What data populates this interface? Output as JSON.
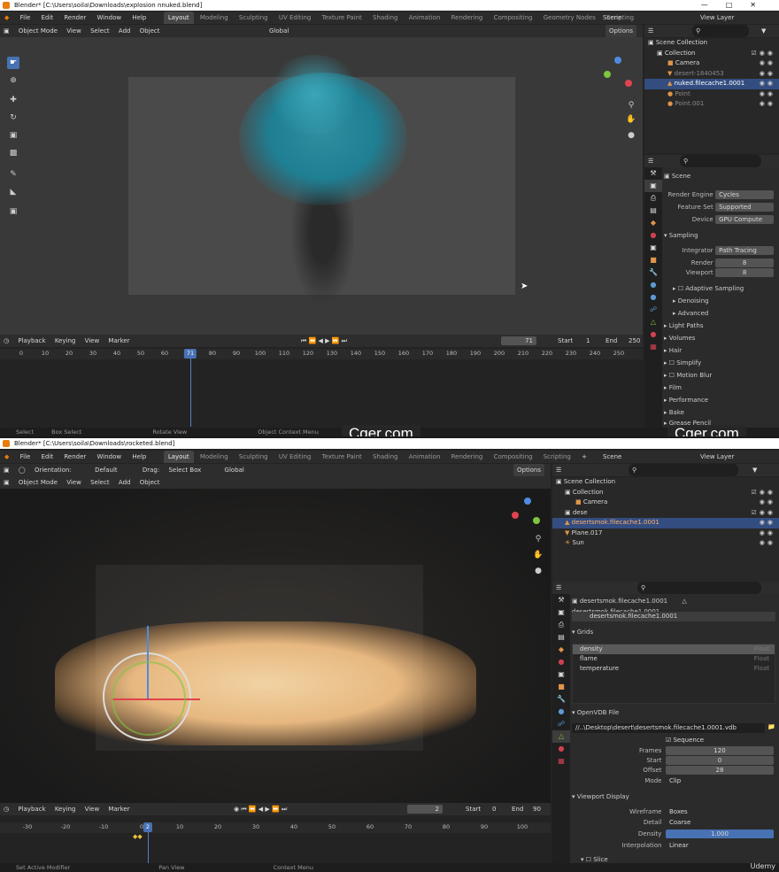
{
  "top": {
    "title": "Blender* [C:\\Users\\soila\\Downloads\\explosion nnuked.blend]",
    "menu": [
      "File",
      "Edit",
      "Render",
      "Window",
      "Help"
    ],
    "tabs": [
      "Layout",
      "Modeling",
      "Sculpting",
      "UV Editing",
      "Texture Paint",
      "Shading",
      "Animation",
      "Rendering",
      "Compositing",
      "Geometry Nodes",
      "Scripting"
    ],
    "scene": "Scene",
    "view_layer": "View Layer",
    "header": {
      "mode": "Object Mode",
      "view": "View",
      "select": "Select",
      "add": "Add",
      "object": "Object",
      "orientation": "Global",
      "options": "Options"
    },
    "outliner": {
      "rows": [
        {
          "name": "Scene Collection"
        },
        {
          "name": "Collection"
        },
        {
          "name": "Camera"
        },
        {
          "name": "desert-1840453"
        },
        {
          "name": "nuked.filecache1.0001"
        },
        {
          "name": "Point"
        },
        {
          "name": "Point.001"
        }
      ]
    },
    "props": {
      "context": "Scene",
      "render_engine_label": "Render Engine",
      "render_engine": "Cycles",
      "feature_set_label": "Feature Set",
      "feature_set": "Supported",
      "device_label": "Device",
      "device": "GPU Compute",
      "sampling": "Sampling",
      "integrator_label": "Integrator",
      "integrator": "Path Tracing",
      "render_label": "Render",
      "render": "8",
      "viewport_label": "Viewport",
      "viewport": "8",
      "adaptive": "Adaptive Sampling",
      "denoising": "Denoising",
      "advanced": "Advanced",
      "panels": [
        "Light Paths",
        "Volumes",
        "Hair",
        "Simplify",
        "Motion Blur",
        "Film",
        "Performance",
        "Bake",
        "Grease Pencil"
      ]
    },
    "timeline": {
      "menu": [
        "Playback",
        "Keying",
        "View",
        "Marker"
      ],
      "frame": "71",
      "start_label": "Start",
      "start": "1",
      "end_label": "End",
      "end": "250",
      "ticks": [
        "0",
        "10",
        "20",
        "30",
        "40",
        "50",
        "60",
        "70",
        "80",
        "90",
        "100",
        "110",
        "120",
        "130",
        "140",
        "150",
        "160",
        "170",
        "180",
        "190",
        "200",
        "210",
        "220",
        "230",
        "240",
        "250"
      ],
      "current": "71"
    },
    "status": [
      "Select",
      "Box Select",
      "Rotate View",
      "Object Context Menu"
    ]
  },
  "watermark": "Cger.com",
  "udemy": "Udemy",
  "bottom": {
    "title": "Blender* [C:\\Users\\soila\\Downloads\\rocketed.blend]",
    "menu": [
      "File",
      "Edit",
      "Render",
      "Window",
      "Help"
    ],
    "tabs": [
      "Layout",
      "Modeling",
      "Sculpting",
      "UV Editing",
      "Texture Paint",
      "Shading",
      "Animation",
      "Rendering",
      "Compositing",
      "Scripting"
    ],
    "scene": "Scene",
    "view_layer": "View Layer",
    "tool_header": {
      "orientation_label": "Orientation:",
      "orientation": "Default",
      "drag_label": "Drag:",
      "drag": "Select Box",
      "transform": "Global",
      "options": "Options"
    },
    "header": {
      "mode": "Object Mode",
      "view": "View",
      "select": "Select",
      "add": "Add",
      "object": "Object"
    },
    "outliner": {
      "rows": [
        {
          "name": "Scene Collection"
        },
        {
          "name": "Collection"
        },
        {
          "name": "Camera"
        },
        {
          "name": "dese"
        },
        {
          "name": "desertsmok.filecache1.0001"
        },
        {
          "name": "Plane.017"
        },
        {
          "name": "Sun"
        }
      ]
    },
    "props": {
      "object": "desertsmok.filecache1.0001",
      "data": "desertsmok.filecache1.0001",
      "datablock": "desertsmok.filecache1.0001",
      "grids_title": "Grids",
      "grids": [
        {
          "name": "density",
          "type": "Float"
        },
        {
          "name": "flame",
          "type": "Float"
        },
        {
          "name": "temperature",
          "type": "Float"
        }
      ],
      "openvdb": "OpenVDB File",
      "filepath": "//..\\Desktop\\desert\\desertsmok.filecache1.0001.vdb",
      "sequence": "Sequence",
      "frames_label": "Frames",
      "frames": "120",
      "start_label": "Start",
      "start": "0",
      "offset_label": "Offset",
      "offset": "28",
      "mode_label": "Mode",
      "mode": "Clip",
      "viewport_display": "Viewport Display",
      "wireframe_label": "Wireframe",
      "wireframe": "Boxes",
      "detail_label": "Detail",
      "detail": "Coarse",
      "density_label": "Density",
      "density": "1.000",
      "interp_label": "Interpolation",
      "interp": "Linear",
      "slice": "Slice"
    },
    "timeline": {
      "menu": [
        "Playback",
        "Keying",
        "View",
        "Marker"
      ],
      "frame": "2",
      "start_label": "Start",
      "start": "0",
      "end_label": "End",
      "end": "90",
      "ticks": [
        "-30",
        "-20",
        "-10",
        "0",
        "10",
        "20",
        "30",
        "40",
        "50",
        "60",
        "70",
        "80",
        "90",
        "100"
      ],
      "current": "2"
    },
    "status": [
      "Set Active Modifier",
      "Pan View",
      "Context Menu"
    ]
  }
}
